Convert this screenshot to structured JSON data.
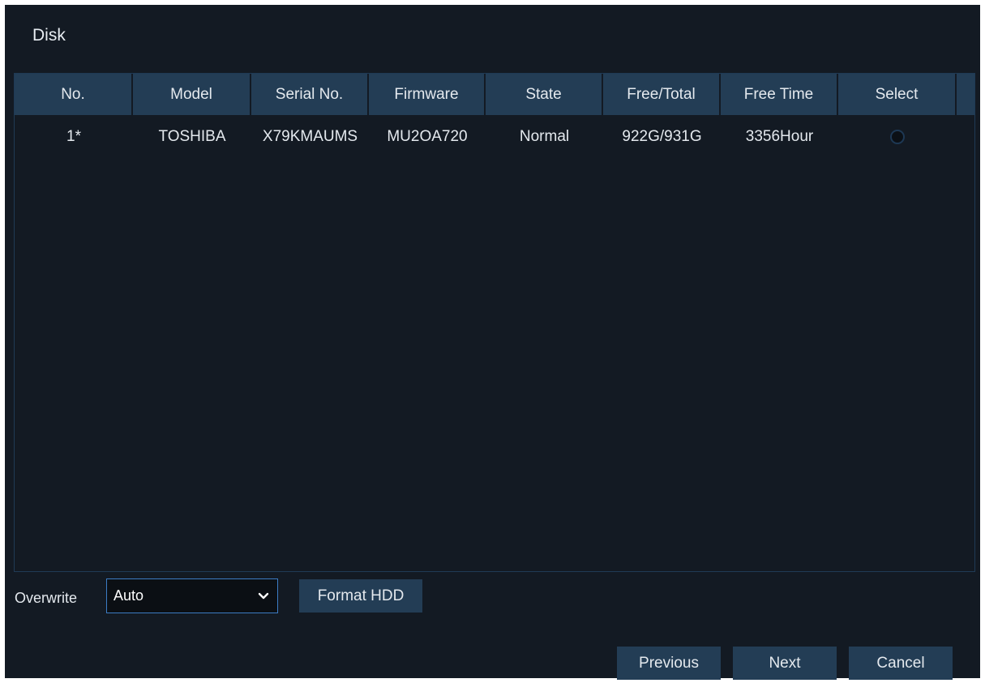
{
  "page_title": "Disk",
  "table": {
    "headers": [
      "No.",
      "Model",
      "Serial No.",
      "Firmware",
      "State",
      "Free/Total",
      "Free Time",
      "Select"
    ],
    "rows": [
      {
        "no": "1*",
        "model": "TOSHIBA",
        "serial": "X79KMAUMS",
        "firmware": "MU2OA720",
        "state": "Normal",
        "free_total": "922G/931G",
        "free_time": "3356Hour",
        "selected": false
      }
    ]
  },
  "overwrite": {
    "label": "Overwrite",
    "value": "Auto"
  },
  "buttons": {
    "format_hdd": "Format HDD",
    "previous": "Previous",
    "next": "Next",
    "cancel": "Cancel"
  },
  "colors": {
    "background": "#131a23",
    "header": "#233d55",
    "accent_border": "#3c7cc4"
  }
}
